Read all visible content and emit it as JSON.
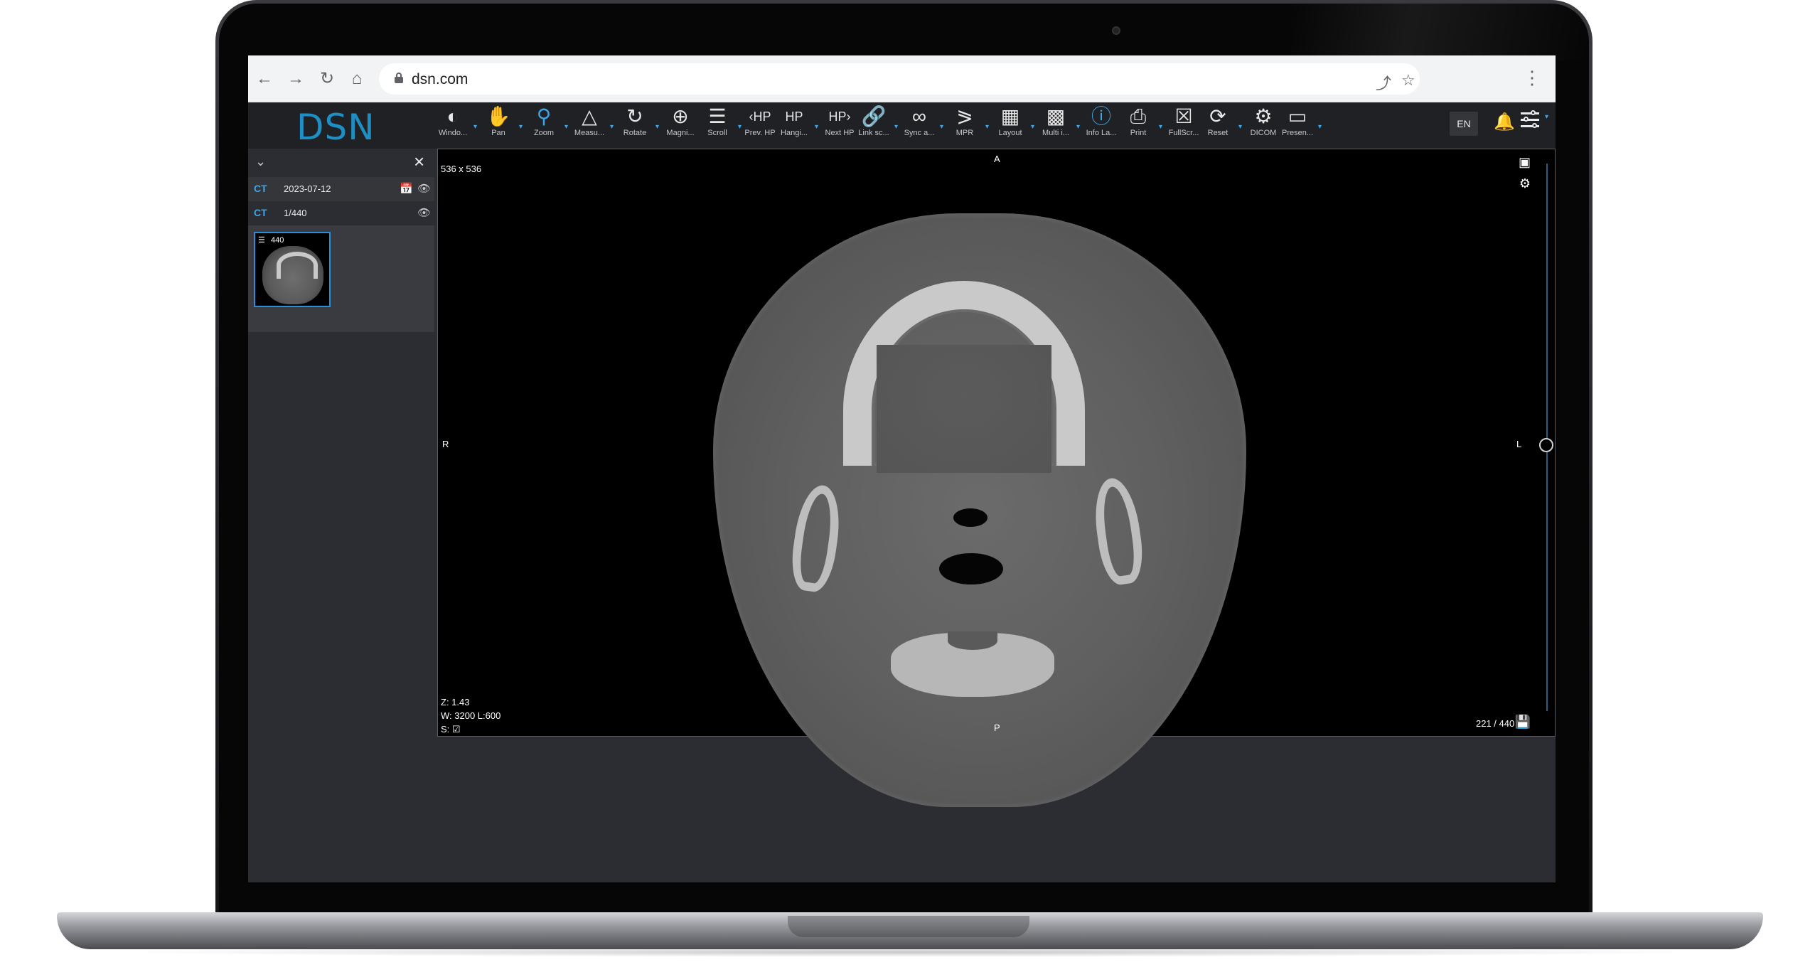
{
  "browser": {
    "url": "dsn.com",
    "icons": [
      "back-arrow-icon",
      "forward-arrow-icon",
      "reload-icon",
      "home-icon",
      "lock-icon",
      "share-icon",
      "star-icon",
      "more-vert-icon"
    ]
  },
  "app": {
    "logo": "DSN",
    "toolbar": [
      {
        "label": "Windo...",
        "icon": "window-level-icon"
      },
      {
        "label": "Pan",
        "icon": "pan-hand-icon"
      },
      {
        "label": "Zoom",
        "icon": "zoom-icon"
      },
      {
        "label": "Measu...",
        "icon": "measure-icon"
      },
      {
        "label": "Rotate",
        "icon": "rotate-icon"
      },
      {
        "label": "Magni...",
        "icon": "magnify-icon"
      },
      {
        "label": "Scroll",
        "icon": "scroll-layers-icon"
      },
      {
        "label": "Prev. HP",
        "icon": "prev-hp-icon"
      },
      {
        "label": "Hangi...",
        "icon": "hanging-protocol-icon"
      },
      {
        "label": "Next HP",
        "icon": "next-hp-icon"
      },
      {
        "label": "Link sc...",
        "icon": "link-scroll-icon"
      },
      {
        "label": "Sync a...",
        "icon": "sync-icon"
      },
      {
        "label": "MPR",
        "icon": "mpr-icon"
      },
      {
        "label": "Layout",
        "icon": "layout-grid-icon"
      },
      {
        "label": "Multi i...",
        "icon": "multi-image-icon"
      },
      {
        "label": "Info La...",
        "icon": "info-layer-icon"
      },
      {
        "label": "Print",
        "icon": "print-icon"
      },
      {
        "label": "FullScr...",
        "icon": "fullscreen-icon"
      },
      {
        "label": "Reset",
        "icon": "reset-icon"
      },
      {
        "label": "DICOM",
        "icon": "dicom-gear-icon"
      },
      {
        "label": "Presen...",
        "icon": "presentation-icon"
      }
    ],
    "language": "EN",
    "accent_color": "#3aa7ec"
  },
  "sidebar": {
    "study": {
      "modality": "CT",
      "date": "2023-07-12"
    },
    "series": {
      "modality": "CT",
      "index": "1/440"
    },
    "thumbnail": {
      "count": "440"
    }
  },
  "viewer": {
    "dimensions": "536 x 536",
    "orient_top": "A",
    "orient_bottom": "P",
    "orient_left": "R",
    "orient_right": "L",
    "zoom": "Z: 1.43",
    "window": "W: 3200 L:600",
    "sync": "S:",
    "slice": "221 / 440"
  }
}
